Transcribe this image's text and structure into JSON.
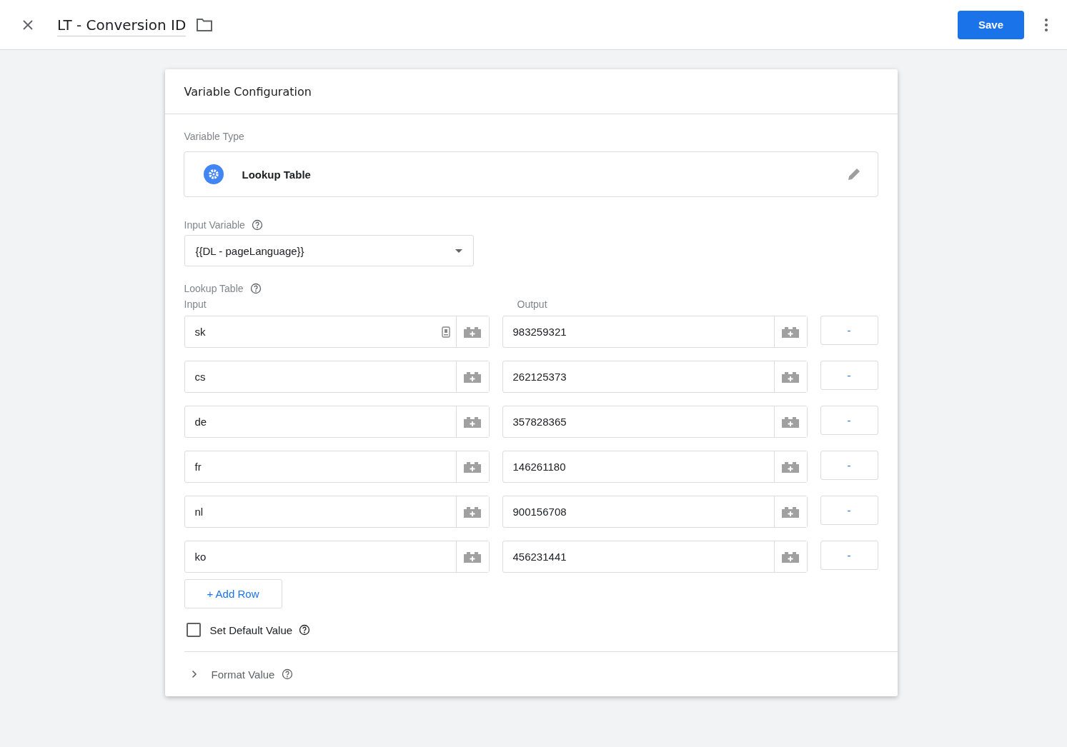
{
  "header": {
    "title": "LT - Conversion ID",
    "save_label": "Save"
  },
  "card": {
    "title": "Variable Configuration",
    "variable_type_label": "Variable Type",
    "variable_type": "Lookup Table",
    "input_variable_label": "Input Variable",
    "input_variable": "{{DL - pageLanguage}}",
    "lookup_label": "Lookup Table",
    "input_heading": "Input",
    "output_heading": "Output",
    "rows": [
      {
        "input": "sk",
        "output": "983259321",
        "remove": "-",
        "field_icon": true
      },
      {
        "input": "cs",
        "output": "262125373",
        "remove": "-",
        "field_icon": false
      },
      {
        "input": "de",
        "output": "357828365",
        "remove": "-",
        "field_icon": false
      },
      {
        "input": "fr",
        "output": "146261180",
        "remove": "-",
        "field_icon": false
      },
      {
        "input": "nl",
        "output": "900156708",
        "remove": "-",
        "field_icon": false
      },
      {
        "input": "ko",
        "output": "456231441",
        "remove": "-",
        "field_icon": false
      }
    ],
    "add_row": "+ Add Row",
    "default_value": {
      "label": "Set Default Value",
      "checked": false
    },
    "format_value": {
      "label": "Format Value",
      "expanded": false
    }
  }
}
